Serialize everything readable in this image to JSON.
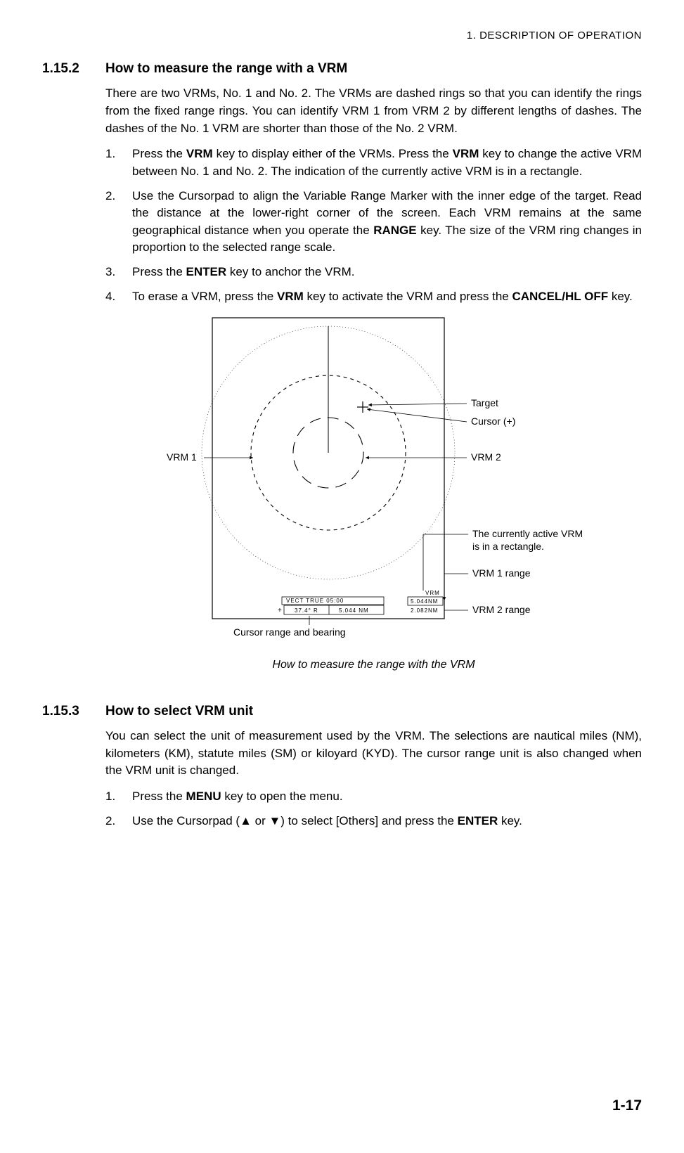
{
  "header": {
    "title": "1.  DESCRIPTION OF OPERATION"
  },
  "s1": {
    "num": "1.15.2",
    "title": "How to measure the range with a VRM",
    "intro": "There are two VRMs, No. 1 and No. 2. The VRMs are dashed rings so that you can identify the rings from the fixed range rings. You can identify VRM 1 from VRM 2 by different lengths of dashes. The dashes of the No. 1 VRM are shorter than those of the No. 2 VRM.",
    "steps": [
      {
        "n": "1.",
        "a": "Press the ",
        "b": "VRM",
        "c": " key to display either of the VRMs. Press the ",
        "d": "VRM",
        "e": " key to change the active VRM between No. 1 and No. 2. The indication of the currently active VRM is in a rectangle."
      },
      {
        "n": "2.",
        "a": "Use the Cursorpad to align the Variable Range Marker with the inner edge of the target. Read the distance at the lower-right corner of the screen. Each VRM remains at the same geographical distance when you operate the ",
        "b": "RANGE",
        "c": " key. The size of the VRM ring changes in proportion to the selected range scale."
      },
      {
        "n": "3.",
        "a": "Press the ",
        "b": "ENTER",
        "c": " key to anchor the VRM."
      },
      {
        "n": "4.",
        "a": "To erase a VRM, press the ",
        "b": "VRM",
        "c": " key to activate the VRM and press the ",
        "d": "CANCEL/HL OFF",
        "e": " key."
      }
    ]
  },
  "figure": {
    "labels": {
      "target": "Target",
      "cursor": "Cursor (+)",
      "vrm1": "VRM 1",
      "vrm2": "VRM 2",
      "active": "The currently active VRM",
      "active2": "is in a rectangle.",
      "r1": "VRM 1 range",
      "r2": "VRM 2 range",
      "crb": "Cursor range and bearing"
    },
    "box": {
      "vrm": "VRM",
      "v1": "5.044NM",
      "v2": "2.082NM",
      "vect": "VECT  TRUE   05:00",
      "bear1": "37.4° R",
      "bear2": "5.044 NM"
    },
    "caption": "How to measure the range with the VRM"
  },
  "s2": {
    "num": "1.15.3",
    "title": "How to select VRM unit",
    "intro": "You can select the unit of measurement used by the VRM. The selections are nautical miles (NM), kilometers (KM), statute miles (SM) or kiloyard (KYD). The cursor range unit is also changed when the VRM unit is changed.",
    "steps": [
      {
        "n": "1.",
        "a": "Press the ",
        "b": "MENU",
        "c": " key to open the menu."
      },
      {
        "n": "2.",
        "a": "Use the Cursorpad (▲ or ▼) to select [Others] and press the ",
        "b": "ENTER",
        "c": " key."
      }
    ]
  },
  "pagenum": "1-17"
}
